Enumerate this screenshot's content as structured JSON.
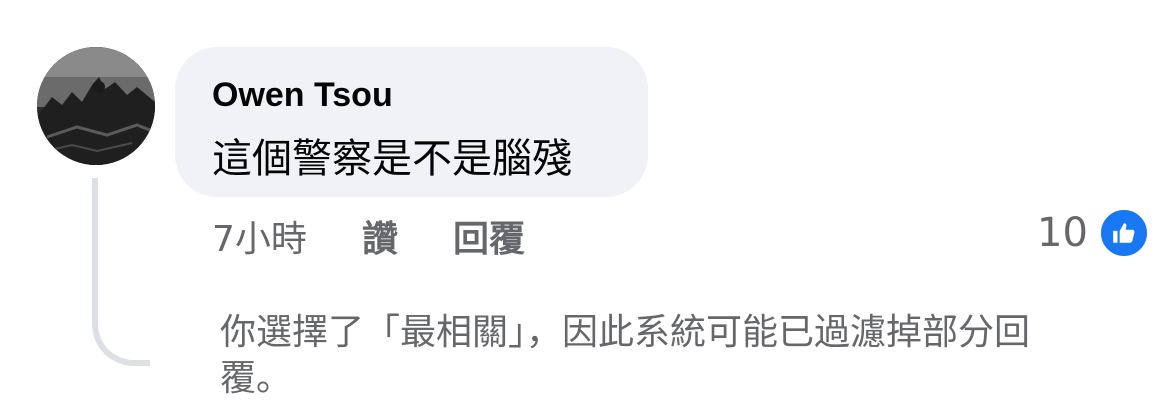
{
  "comment": {
    "author": "Owen Tsou",
    "text": "這個警察是不是腦殘",
    "time": "7小時",
    "like_label": "讚",
    "reply_label": "回覆",
    "reaction_count": "10",
    "reaction_icon": "thumbs-up-icon"
  },
  "notice": {
    "text": "你選擇了「最相關」，因此系統可能已過濾掉部分回覆。"
  },
  "colors": {
    "accent": "#1877f2",
    "bubble": "#f0f2f5",
    "secondary_text": "#65676b",
    "primary_text": "#050505",
    "thread_line": "#dcdfe3"
  }
}
